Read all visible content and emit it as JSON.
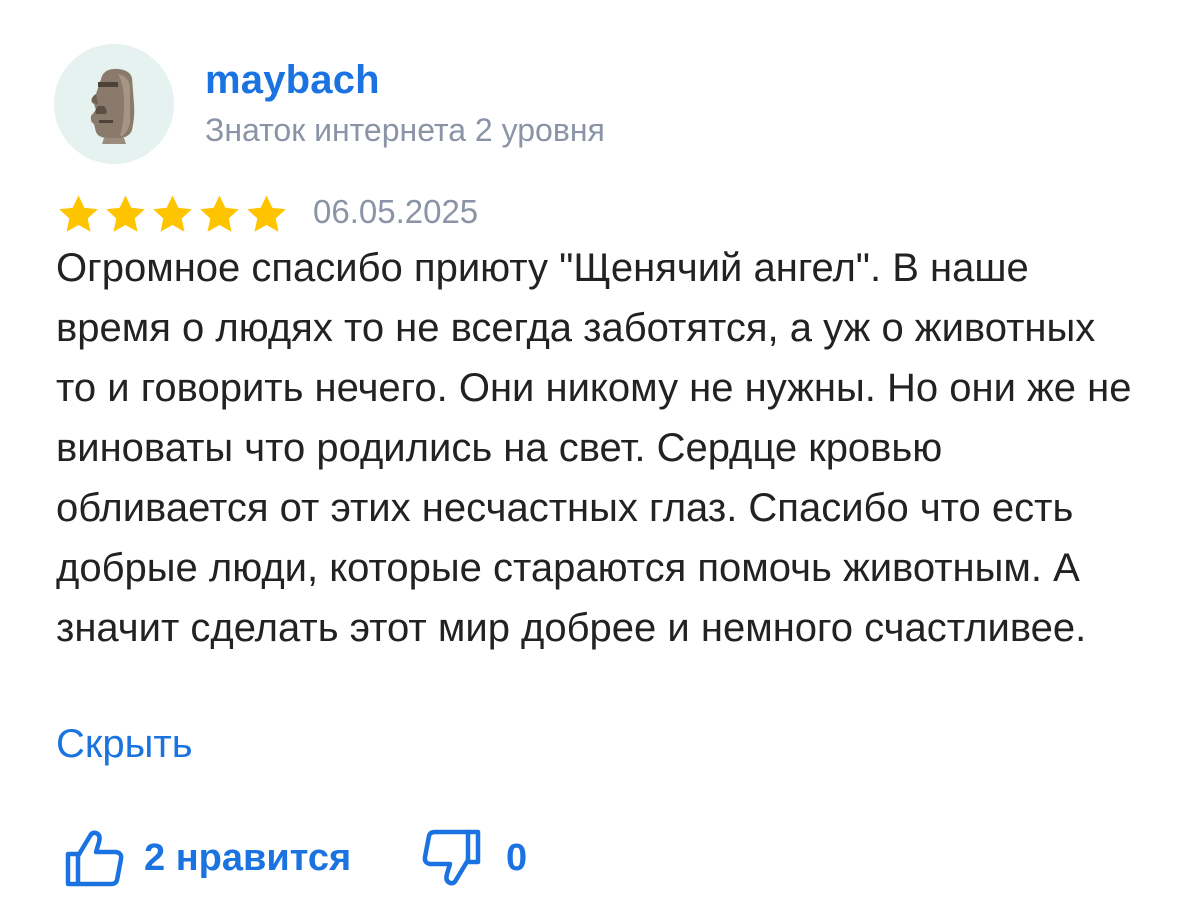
{
  "author": {
    "avatar_icon": "moai-statue-avatar",
    "name": "maybach",
    "level": "Знаток интернета 2 уровня"
  },
  "rating": {
    "stars": 5,
    "max": 5,
    "star_color": "#ffc400"
  },
  "date": "06.05.2025",
  "review_text": "Огромное спасибо приюту \"Щенячий ангел\". В наше время о людях то не всегда заботятся, а уж о животных то и говорить нечего. Они никому не нужны. Но они же не виноваты что родились на свет. Сердце кровью обливается от этих несчастных глаз. Спасибо что есть добрые люди, которые стараются помочь животным. А значит сделать этот мир добрее и немного счастливее.",
  "hide_label": "Скрыть",
  "reactions": {
    "like_label": "2 нравится",
    "like_icon": "thumbs-up-icon",
    "dislike_count": "0",
    "dislike_icon": "thumbs-down-icon"
  },
  "colors": {
    "accent": "#1a73e0",
    "muted": "#8a94a6",
    "text": "#222222"
  }
}
